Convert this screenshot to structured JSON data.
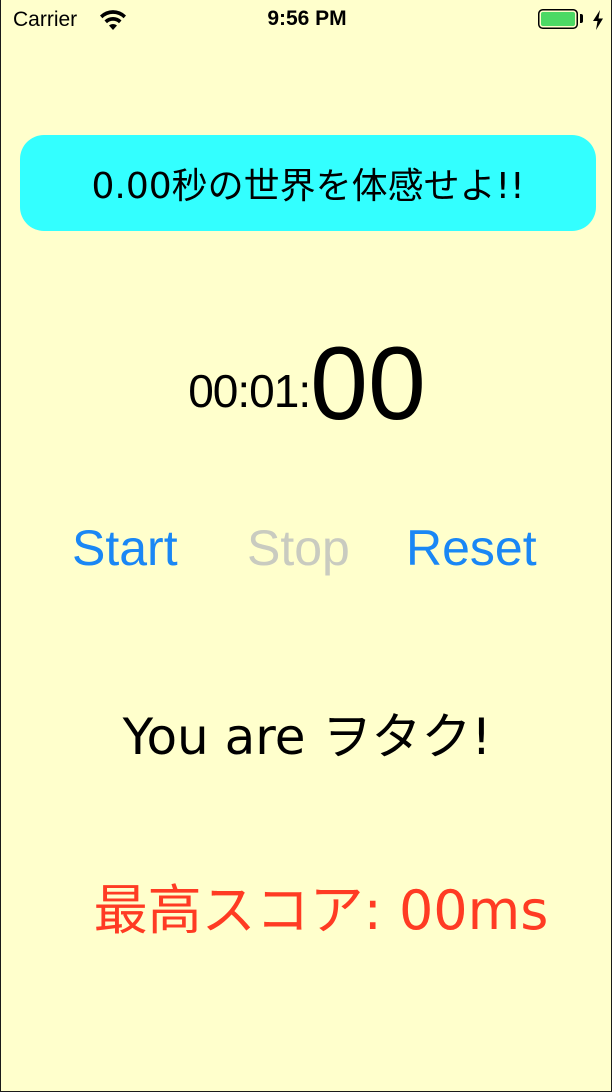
{
  "status_bar": {
    "carrier": "Carrier",
    "time": "9:56 PM",
    "icons": [
      "wifi-icon",
      "battery-icon",
      "charging-icon"
    ],
    "battery_color": "#4cd964"
  },
  "banner": {
    "text": "0.00秒の世界を体感せよ!!",
    "background": "#33ffff"
  },
  "timer": {
    "prefix": "00:01:",
    "centis": "00"
  },
  "controls": {
    "start": "Start",
    "stop": "Stop",
    "reset": "Reset",
    "active_color": "#1a87f5",
    "disabled_color": "#c9cbc0"
  },
  "message": {
    "text": "You are ヲタク!"
  },
  "best_score": {
    "text": "最高スコア:  00ms",
    "color": "#ff3b23"
  },
  "theme": {
    "background": "#ffffcc"
  }
}
